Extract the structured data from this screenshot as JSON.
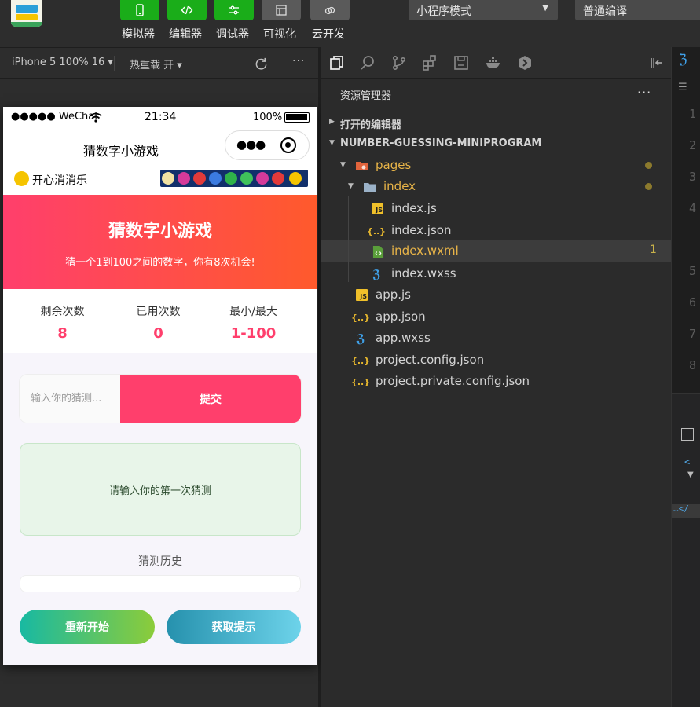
{
  "toolbar": {
    "tools": [
      {
        "label": "模拟器",
        "icon": "phone-icon"
      },
      {
        "label": "编辑器",
        "icon": "code-icon"
      },
      {
        "label": "调试器",
        "icon": "debug-icon"
      },
      {
        "label": "可视化",
        "icon": "layout-icon"
      },
      {
        "label": "云开发",
        "icon": "cloud-icon"
      }
    ],
    "mode": "小程序模式",
    "compile": "普通编译"
  },
  "simulator_bar": {
    "device": "iPhone 5 100% 16 ▾",
    "hot_reload": "热重载 开 ▾"
  },
  "phone": {
    "status": {
      "signal": "●●●●● WeChat",
      "time": "21:34",
      "battery": "100%"
    },
    "nav_title": "猜数字小游戏",
    "ad": {
      "name": "开心消消乐"
    },
    "hero": {
      "title": "猜数字小游戏",
      "subtitle": "猜一个1到100之间的数字，你有8次机会!"
    },
    "stats": [
      {
        "label": "剩余次数",
        "value": "8"
      },
      {
        "label": "已用次数",
        "value": "0"
      },
      {
        "label": "最小/最大",
        "value": "1-100"
      }
    ],
    "input_placeholder": "输入你的猜测...",
    "submit": "提交",
    "message": "请输入你的第一次猜测",
    "history_title": "猜测历史",
    "restart": "重新开始",
    "hint": "获取提示",
    "colors": {
      "primary": "#ff3f6c",
      "hero_end": "#ff5a2c"
    }
  },
  "explorer": {
    "title": "资源管理器",
    "more": "···",
    "open_editors": "打开的编辑器",
    "project": "NUMBER-GUESSING-MINIPROGRAM",
    "pages": "pages",
    "index": "index",
    "files": {
      "index_js": "index.js",
      "index_json": "index.json",
      "index_wxml": "index.wxml",
      "index_wxss": "index.wxss",
      "app_js": "app.js",
      "app_json": "app.json",
      "app_wxss": "app.wxss",
      "project_config": "project.config.json",
      "project_private": "project.private.config.json"
    },
    "wxml_problems": "1"
  },
  "code": {
    "line_numbers": [
      "1",
      "2",
      "3",
      "4",
      "5",
      "6",
      "7",
      "8"
    ]
  }
}
